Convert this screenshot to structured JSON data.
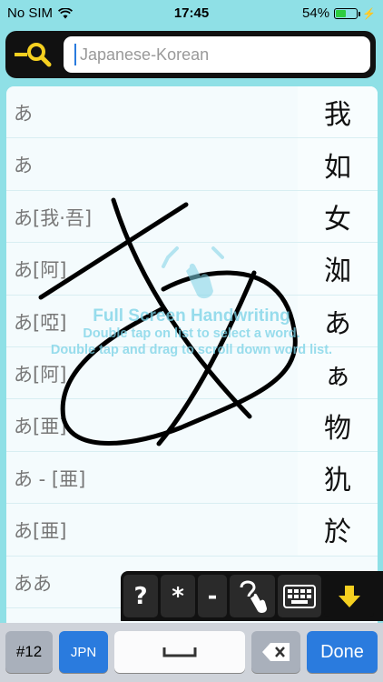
{
  "status": {
    "carrier": "No SIM",
    "time": "17:45",
    "battery": "54%",
    "battery_level": 0.54
  },
  "search": {
    "placeholder": "Japanese-Korean"
  },
  "list": [
    {
      "word": "あ",
      "kanji": "我"
    },
    {
      "word": "あ",
      "kanji": "如"
    },
    {
      "word": "あ[我·吾]",
      "kanji": "女"
    },
    {
      "word": "あ[阿]",
      "kanji": "洳"
    },
    {
      "word": "あ[啞]",
      "kanji": "あ"
    },
    {
      "word": "あ[阿]",
      "kanji": "ぁ"
    },
    {
      "word": "あ[亜]",
      "kanji": "物"
    },
    {
      "word": "あ - [亜]",
      "kanji": "犰"
    },
    {
      "word": "あ[亜]",
      "kanji": "於"
    },
    {
      "word": "ああ",
      "kanji": ""
    }
  ],
  "overlay": {
    "title": "Full Screen Handwriting",
    "line1": "Double tap on list to select a word.",
    "line2": "Double tap and drag to scroll down word list."
  },
  "toolbar": {
    "help": "?",
    "wildcard_star": "*",
    "wildcard_dash": "-"
  },
  "keyboard": {
    "numbers": "#12",
    "lang": "JPN",
    "done": "Done"
  },
  "colors": {
    "background": "#8fe0e6",
    "accent_yellow": "#f5d020",
    "done_blue": "#2a7bde"
  }
}
